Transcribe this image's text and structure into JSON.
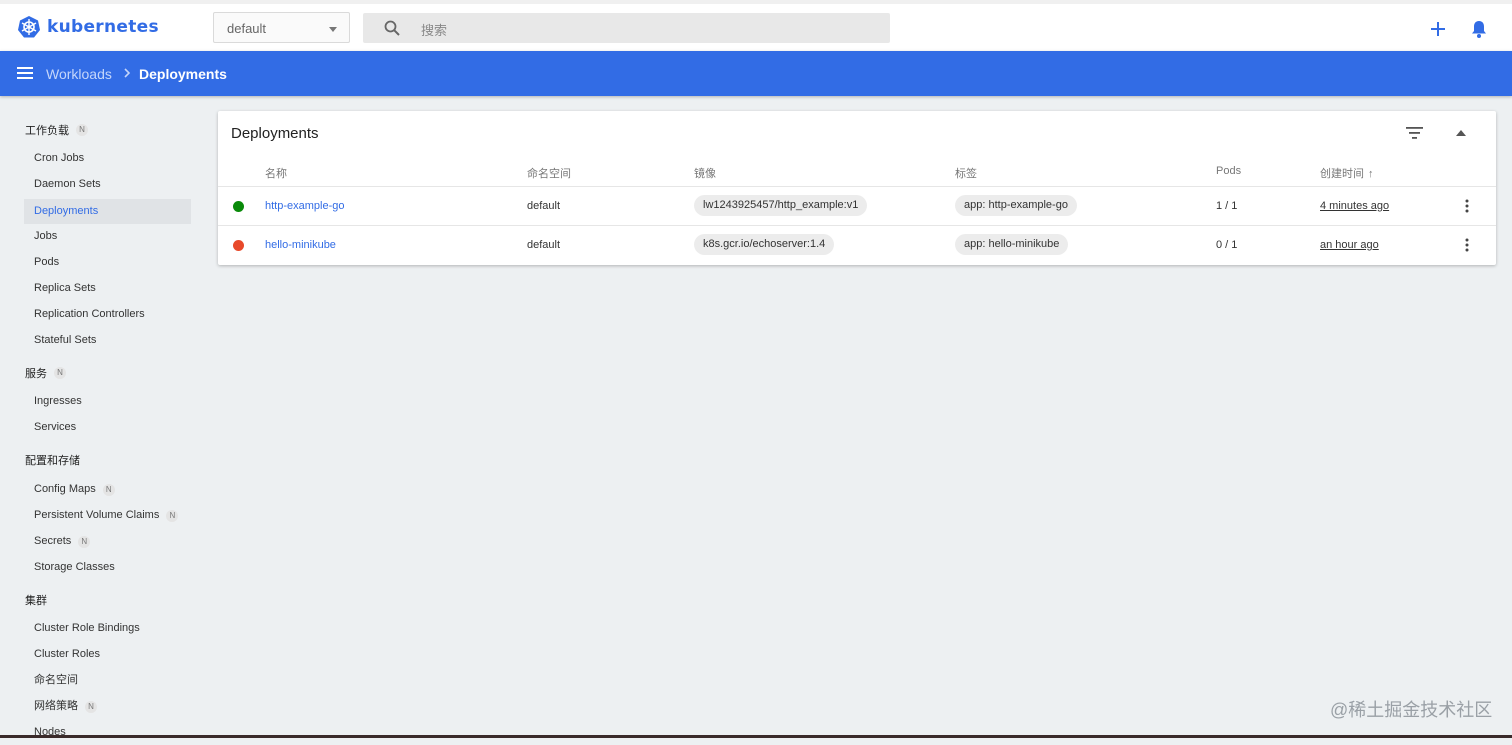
{
  "app": {
    "name": "kubernetes",
    "brand_color": "#326ce5"
  },
  "namespace_selector": {
    "value": "default"
  },
  "search": {
    "placeholder": "搜索"
  },
  "breadcrumb": {
    "parent": "Workloads",
    "current": "Deployments"
  },
  "sidebar": {
    "sections": [
      {
        "title": "工作负载",
        "badge": "N",
        "items": [
          "Cron Jobs",
          "Daemon Sets",
          "Deployments",
          "Jobs",
          "Pods",
          "Replica Sets",
          "Replication Controllers",
          "Stateful Sets"
        ]
      },
      {
        "title": "服务",
        "badge": "N",
        "items": [
          "Ingresses",
          "Services"
        ]
      },
      {
        "title": "配置和存储",
        "items": [
          "Config Maps",
          "Persistent Volume Claims",
          "Secrets",
          "Storage Classes"
        ],
        "item_badges": {
          "Config Maps": "N",
          "Persistent Volume Claims": "N",
          "Secrets": "N"
        }
      },
      {
        "title": "集群",
        "items": [
          "Cluster Role Bindings",
          "Cluster Roles",
          "命名空间",
          "网络策略",
          "Nodes"
        ],
        "item_badges": {
          "网络策略": "N"
        }
      }
    ],
    "active_item": "Deployments",
    "badge_text": "N"
  },
  "card": {
    "title": "Deployments",
    "columns": [
      "名称",
      "命名空间",
      "镜像",
      "标签",
      "Pods",
      "创建时间"
    ],
    "sort_indicator": "↑",
    "rows": [
      {
        "status_color": "#0a8a0a",
        "name": "http-example-go",
        "namespace": "default",
        "image": "lw1243925457/http_example:v1",
        "label": "app: http-example-go",
        "pods": "1 / 1",
        "created": "4 minutes ago"
      },
      {
        "status_color": "#e8492a",
        "name": "hello-minikube",
        "namespace": "default",
        "image": "k8s.gcr.io/echoserver:1.4",
        "label": "app: hello-minikube",
        "pods": "0 / 1",
        "created": "an hour ago"
      }
    ]
  },
  "watermark": "@稀土掘金技术社区"
}
